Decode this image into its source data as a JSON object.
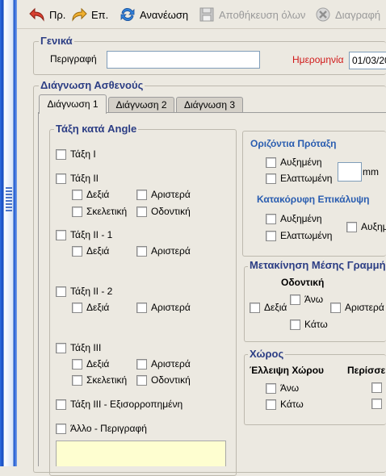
{
  "toolbar": {
    "prev_label": "Πρ.",
    "next_label": "Επ.",
    "refresh_label": "Ανανέωση",
    "save_all_label": "Αποθήκευση όλων",
    "delete_label": "Διαγραφή"
  },
  "general": {
    "title": "Γενικά",
    "description_label": "Περιγραφή",
    "description_value": "",
    "date_label": "Ημερομηνία",
    "date_value": "01/03/20"
  },
  "diagnosis": {
    "title": "Διάγνωση Ασθενούς",
    "tabs": [
      "Διάγνωση 1",
      "Διάγνωση 2",
      "Διάγνωση 3"
    ],
    "active_tab": 0
  },
  "angle": {
    "title": "Τάξη κατά Angle",
    "class1": "Τάξη I",
    "class2": "Τάξη II",
    "right": "Δεξιά",
    "left": "Αριστερά",
    "skeletal": "Σκελετική",
    "dental": "Οδοντική",
    "class2_1": "Τάξη II - 1",
    "class2_2": "Τάξη II - 2",
    "class3": "Τάξη III",
    "class3_comp": "Τάξη III - Εξισορροπημένη",
    "other": "Άλλο - Περιγραφή"
  },
  "overjet": {
    "title": "Οριζόντια Πρόταξη",
    "increased": "Αυξημένη",
    "decreased": "Ελαττωμένη",
    "value": "",
    "unit": "mm"
  },
  "overbite": {
    "title": "Κατακόρυφη Επικάλυψη",
    "increased": "Αυξημένη",
    "decreased": "Ελαττωμένη",
    "increased_2": "Αυξημ"
  },
  "midline": {
    "title": "Μετακίνηση Μέσης Γραμμής",
    "dental": "Οδοντική",
    "right": "Δεξιά",
    "up": "Άνω",
    "left": "Αριστερά",
    "down": "Κάτω"
  },
  "space": {
    "title": "Χώρος",
    "lack": "Έλλειψη Χώρου",
    "excess": "Περίσσεια",
    "up": "Άνω",
    "down": "Κάτω"
  },
  "colors": {
    "group_title": "#2b3d84",
    "date_label": "#d01818",
    "sub_title": "#2a5db0"
  }
}
